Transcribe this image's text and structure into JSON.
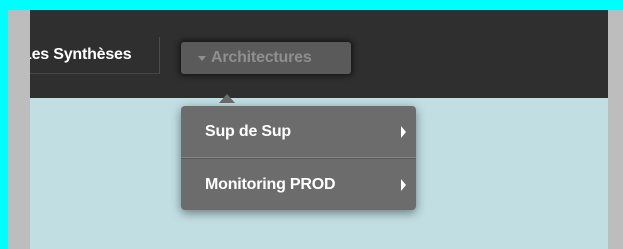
{
  "navbar": {
    "tab_label": "Les Synthèses",
    "dropdown_label": "Architectures"
  },
  "dropdown": {
    "items": [
      {
        "label": "Sup de Sup",
        "has_submenu": true
      },
      {
        "label": "Monitoring PROD",
        "has_submenu": true
      }
    ]
  },
  "colors": {
    "navbar_bg": "#2f2f2f",
    "content_bg": "#c1dfe3",
    "menu_bg": "#6c6c6c",
    "outer_bg": "#00fefe"
  }
}
